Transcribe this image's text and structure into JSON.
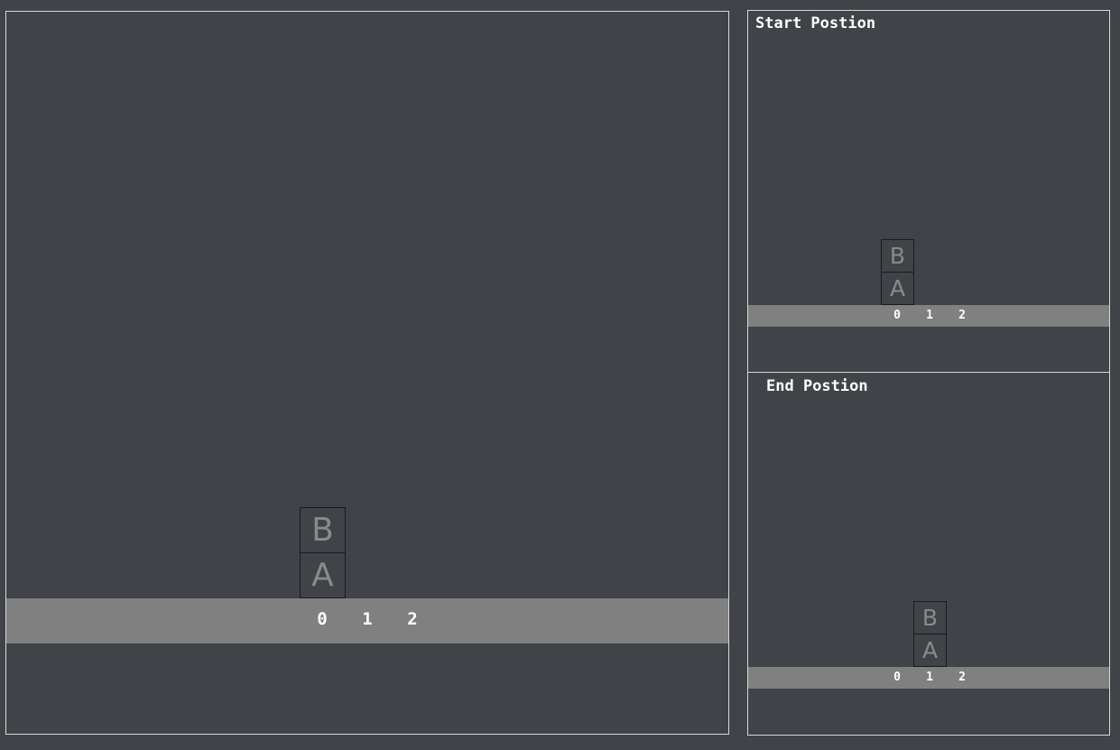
{
  "main_board": {
    "columns": [
      "0",
      "1",
      "2"
    ],
    "blocks": [
      {
        "label": "A",
        "column": 0,
        "level": 0
      },
      {
        "label": "B",
        "column": 0,
        "level": 1
      }
    ]
  },
  "start_board": {
    "title": "Start Postion",
    "columns": [
      "0",
      "1",
      "2"
    ],
    "blocks": [
      {
        "label": "A",
        "column": 0,
        "level": 0
      },
      {
        "label": "B",
        "column": 0,
        "level": 1
      }
    ]
  },
  "end_board": {
    "title": "End Postion",
    "columns": [
      "0",
      "1",
      "2"
    ],
    "blocks": [
      {
        "label": "A",
        "column": 1,
        "level": 0
      },
      {
        "label": "B",
        "column": 1,
        "level": 1
      }
    ]
  },
  "colors": {
    "background": "#404348",
    "ground": "#808080",
    "border": "#d8d8d8",
    "block_text": "#8a8a8a",
    "label_text": "#ffffff"
  }
}
